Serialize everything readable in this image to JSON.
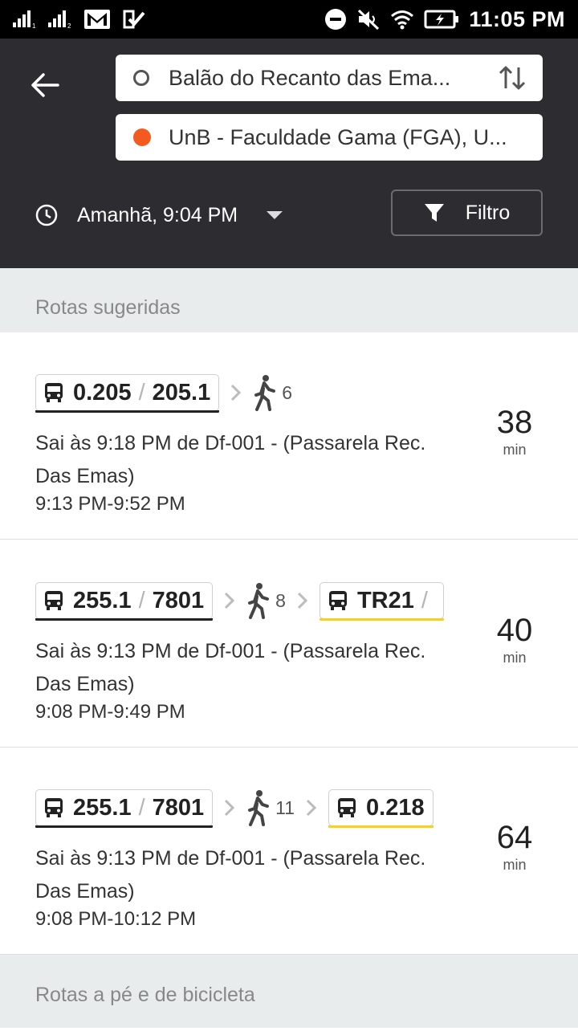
{
  "status_bar": {
    "time": "11:05 PM",
    "left_icons": [
      "signal-sim1-icon",
      "signal-sim2-icon",
      "gmail-icon",
      "task-check-icon"
    ],
    "right_icons": [
      "do-not-disturb-icon",
      "muted-icon",
      "wifi-icon",
      "battery-charging-icon"
    ]
  },
  "header": {
    "origin": "Balão do Recanto das Ema...",
    "destination": "UnB - Faculdade Gama (FGA), U...",
    "departure_time": "Amanhã, 9:04 PM",
    "filter_label": "Filtro",
    "colors": {
      "background": "#2d2d31",
      "destination_dot": "#f25a1f"
    }
  },
  "sections": {
    "suggested": "Rotas sugeridas",
    "walk_bike": "Rotas a pé e de bicicleta"
  },
  "routes": [
    {
      "bus1": {
        "a": "0.205",
        "sep": "/",
        "b": "205.1"
      },
      "walk_min": "6",
      "description": "Sai às 9:18 PM de Df-001 - (Passarela Rec. Das Emas)",
      "times": "9:13 PM-9:52 PM",
      "duration": "38",
      "unit": "min"
    },
    {
      "bus1": {
        "a": "255.1",
        "sep": "/",
        "b": "7801"
      },
      "walk_min": "8",
      "bus2": {
        "a": "TR21",
        "sep": "/"
      },
      "description": "Sai às 9:13 PM de Df-001 - (Passarela Rec. Das Emas)",
      "times": "9:08 PM-9:49 PM",
      "duration": "40",
      "unit": "min"
    },
    {
      "bus1": {
        "a": "255.1",
        "sep": "/",
        "b": "7801"
      },
      "walk_min": "11",
      "bus2": {
        "a": "0.218"
      },
      "description": "Sai às 9:13 PM de Df-001 - (Passarela Rec. Das Emas)",
      "times": "9:08 PM-10:12 PM",
      "duration": "64",
      "unit": "min"
    }
  ],
  "line_colors": {
    "dark": "#222222",
    "yellow": "#f5d21e"
  }
}
